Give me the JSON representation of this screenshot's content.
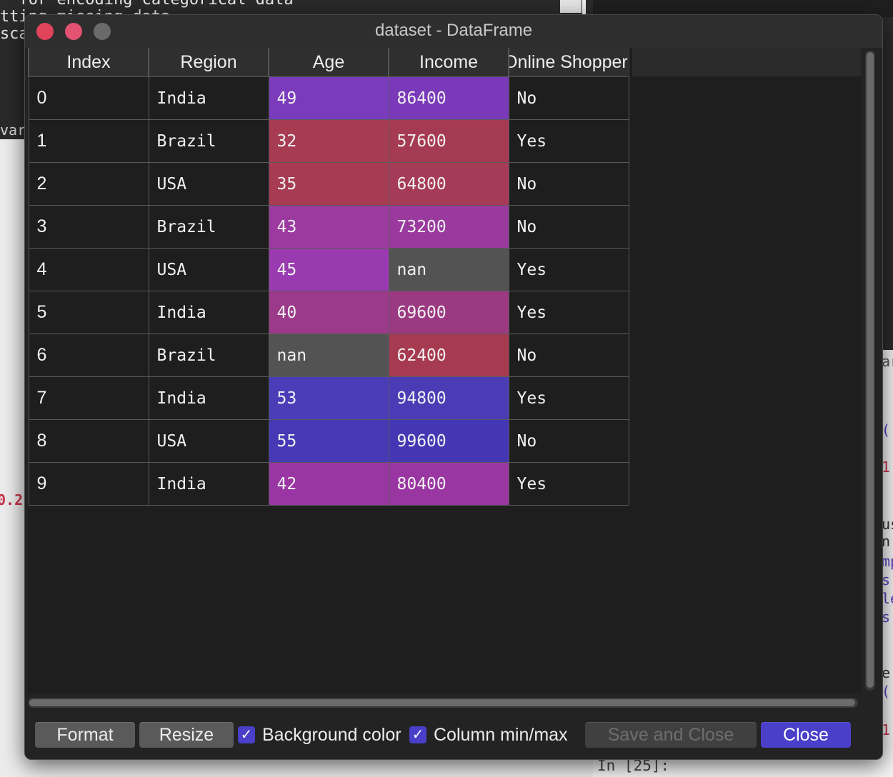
{
  "background": {
    "code_lines": [
      "  for encoding categorical data",
      "tting missing data ...",
      "sca"
    ],
    "left_fragment": "var",
    "left_value": "0.2",
    "right_fragments": [
      "ar",
      "(",
      "1",
      "us",
      "n",
      "mp",
      "s:",
      "le",
      "s:",
      "e",
      "(",
      "1"
    ],
    "console_prompt": "In [25]:"
  },
  "window": {
    "title": "dataset - DataFrame"
  },
  "table": {
    "columns": [
      "Index",
      "Region",
      "Age",
      "Income",
      "Online Shopper"
    ],
    "rows": [
      {
        "index": "0",
        "region": "India",
        "age": "49",
        "income": "86400",
        "online": "No"
      },
      {
        "index": "1",
        "region": "Brazil",
        "age": "32",
        "income": "57600",
        "online": "Yes"
      },
      {
        "index": "2",
        "region": "USA",
        "age": "35",
        "income": "64800",
        "online": "No"
      },
      {
        "index": "3",
        "region": "Brazil",
        "age": "43",
        "income": "73200",
        "online": "No"
      },
      {
        "index": "4",
        "region": "USA",
        "age": "45",
        "income": "nan",
        "online": "Yes"
      },
      {
        "index": "5",
        "region": "India",
        "age": "40",
        "income": "69600",
        "online": "Yes"
      },
      {
        "index": "6",
        "region": "Brazil",
        "age": "nan",
        "income": "62400",
        "online": "No"
      },
      {
        "index": "7",
        "region": "India",
        "age": "53",
        "income": "94800",
        "online": "Yes"
      },
      {
        "index": "8",
        "region": "USA",
        "age": "55",
        "income": "99600",
        "online": "No"
      },
      {
        "index": "9",
        "region": "India",
        "age": "42",
        "income": "80400",
        "online": "Yes"
      }
    ],
    "colors": {
      "age": [
        "#7b3bbd",
        "#a63b52",
        "#a63b52",
        "#9c3aa0",
        "#9a3ab0",
        "#9b3a8a",
        null,
        "#4b3cb8",
        "#4539b6",
        "#9a36a4"
      ],
      "income": [
        "#7a39b9",
        "#a53b52",
        "#a53b57",
        "#9a3a9e",
        null,
        "#9b3a82",
        "#a63a50",
        "#4b3cb6",
        "#4437b4",
        "#9a36a2"
      ]
    },
    "nan_color": "#535353"
  },
  "controls": {
    "format_label": "Format",
    "resize_label": "Resize",
    "background_color_label": "Background color",
    "background_color_checked": true,
    "column_minmax_label": "Column min/max",
    "column_minmax_checked": true,
    "save_close_label": "Save and Close",
    "close_label": "Close",
    "check_glyph": "✓"
  }
}
